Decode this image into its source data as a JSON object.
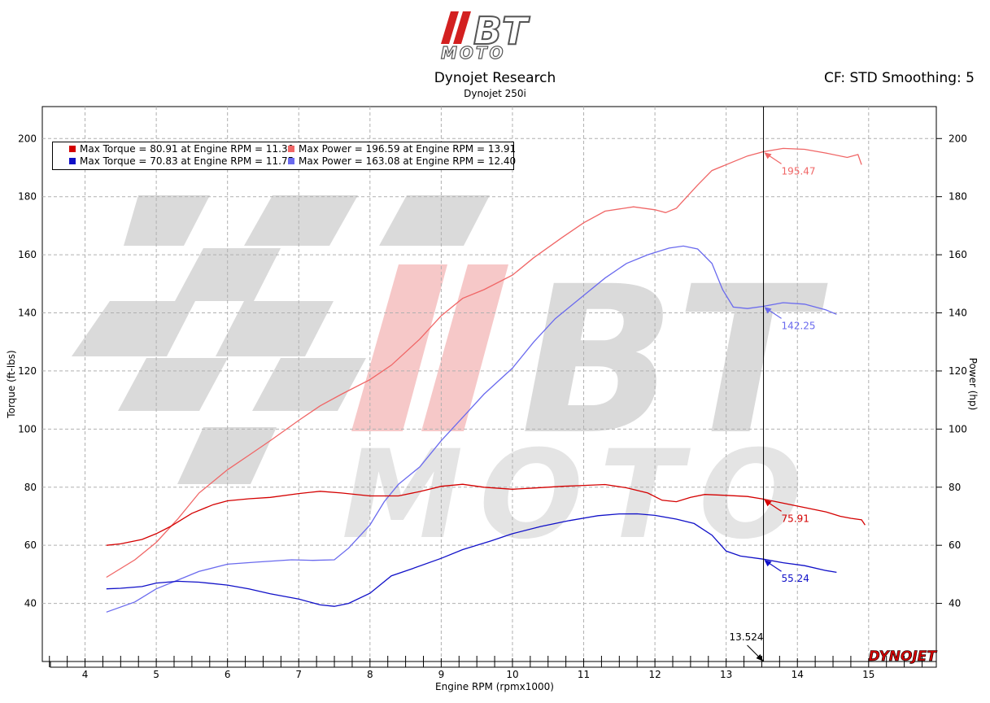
{
  "logo": {
    "letters": "BT",
    "sub": "MOTO"
  },
  "header": {
    "title": "Dynojet Research",
    "subtitle": "Dynojet 250i",
    "correction": "CF: STD Smoothing: 5"
  },
  "watermark": {
    "letters": "BT",
    "sub": "MOTO"
  },
  "brand_mark": "DYNOJET",
  "colors": {
    "torque_red": "#d40000",
    "power_red": "#f06666",
    "torque_blue": "#1010c8",
    "power_blue": "#6a6aee"
  },
  "chart_data": {
    "type": "line",
    "xlabel": "Engine RPM (rpmx1000)",
    "ylabel": "Torque (ft-lbs)",
    "y2label": "Power (hp)",
    "xlim": [
      3.4,
      15.95
    ],
    "ylim": [
      20,
      211
    ],
    "y2lim": [
      20,
      211
    ],
    "x_ticks": [
      4,
      5,
      6,
      7,
      8,
      9,
      10,
      11,
      12,
      13,
      14,
      15
    ],
    "y_ticks": [
      40,
      60,
      80,
      100,
      120,
      140,
      160,
      180,
      200
    ],
    "grid": true,
    "legend": {
      "placement": "top-left",
      "entries": [
        "Max Torque = 80.91 at Engine RPM = 11.30",
        "Max Power = 196.59 at Engine RPM = 13.91",
        "Max Torque = 70.83 at Engine RPM = 11.75",
        "Max Power = 163.08 at Engine RPM = 12.40"
      ]
    },
    "cursor": {
      "x": 13.524,
      "label": "13.524"
    },
    "series": [
      {
        "color": "#f06666",
        "axis": "right",
        "cursor_value": "195.47",
        "points": [
          [
            4.3,
            49
          ],
          [
            4.7,
            55
          ],
          [
            5.0,
            61
          ],
          [
            5.3,
            69
          ],
          [
            5.6,
            78
          ],
          [
            6.0,
            86
          ],
          [
            6.3,
            91
          ],
          [
            6.6,
            96
          ],
          [
            7.0,
            103
          ],
          [
            7.3,
            108
          ],
          [
            7.6,
            112
          ],
          [
            8.0,
            117
          ],
          [
            8.3,
            122
          ],
          [
            8.7,
            131
          ],
          [
            9.0,
            139
          ],
          [
            9.3,
            145
          ],
          [
            9.6,
            148
          ],
          [
            10.0,
            153
          ],
          [
            10.3,
            159
          ],
          [
            10.7,
            166
          ],
          [
            11.0,
            171
          ],
          [
            11.3,
            175
          ],
          [
            11.7,
            176.5
          ],
          [
            12.0,
            175.5
          ],
          [
            12.15,
            174.5
          ],
          [
            12.3,
            176
          ],
          [
            12.6,
            184
          ],
          [
            12.8,
            189
          ],
          [
            13.1,
            192
          ],
          [
            13.3,
            194
          ],
          [
            13.52,
            195.47
          ],
          [
            13.8,
            196.6
          ],
          [
            14.1,
            196.3
          ],
          [
            14.4,
            195
          ],
          [
            14.7,
            193.5
          ],
          [
            14.85,
            194.5
          ],
          [
            14.9,
            191
          ]
        ]
      },
      {
        "color": "#6a6aee",
        "axis": "right",
        "cursor_value": "142.25",
        "points": [
          [
            4.3,
            37
          ],
          [
            4.7,
            40.5
          ],
          [
            5.0,
            45
          ],
          [
            5.3,
            48
          ],
          [
            5.6,
            51
          ],
          [
            6.0,
            53.5
          ],
          [
            6.4,
            54.2
          ],
          [
            6.9,
            55
          ],
          [
            7.2,
            54.8
          ],
          [
            7.5,
            55
          ],
          [
            7.7,
            59
          ],
          [
            8.0,
            67
          ],
          [
            8.2,
            75
          ],
          [
            8.4,
            81
          ],
          [
            8.7,
            87
          ],
          [
            9.0,
            96
          ],
          [
            9.3,
            104
          ],
          [
            9.6,
            112
          ],
          [
            10.0,
            121
          ],
          [
            10.3,
            130
          ],
          [
            10.6,
            138
          ],
          [
            11.0,
            146
          ],
          [
            11.3,
            152
          ],
          [
            11.6,
            157
          ],
          [
            11.9,
            160
          ],
          [
            12.2,
            162.3
          ],
          [
            12.4,
            163
          ],
          [
            12.6,
            162
          ],
          [
            12.8,
            157
          ],
          [
            12.95,
            148
          ],
          [
            13.1,
            142
          ],
          [
            13.3,
            141.5
          ],
          [
            13.52,
            142.25
          ],
          [
            13.8,
            143.5
          ],
          [
            14.1,
            143
          ],
          [
            14.4,
            141
          ],
          [
            14.55,
            139.5
          ]
        ]
      },
      {
        "color": "#d40000",
        "axis": "left",
        "cursor_value": "75.91",
        "points": [
          [
            4.3,
            60
          ],
          [
            4.5,
            60.5
          ],
          [
            4.8,
            62
          ],
          [
            5.0,
            64
          ],
          [
            5.2,
            66.5
          ],
          [
            5.5,
            71
          ],
          [
            5.8,
            74
          ],
          [
            6.0,
            75.3
          ],
          [
            6.3,
            76
          ],
          [
            6.6,
            76.5
          ],
          [
            7.0,
            77.8
          ],
          [
            7.3,
            78.6
          ],
          [
            7.6,
            78
          ],
          [
            8.0,
            77
          ],
          [
            8.4,
            77
          ],
          [
            8.7,
            78.5
          ],
          [
            9.0,
            80.3
          ],
          [
            9.3,
            81
          ],
          [
            9.6,
            80
          ],
          [
            10.0,
            79.3
          ],
          [
            10.3,
            79.7
          ],
          [
            10.7,
            80.3
          ],
          [
            11.0,
            80.6
          ],
          [
            11.3,
            80.9
          ],
          [
            11.6,
            79.8
          ],
          [
            11.9,
            78
          ],
          [
            12.1,
            75.5
          ],
          [
            12.3,
            75
          ],
          [
            12.5,
            76.5
          ],
          [
            12.7,
            77.5
          ],
          [
            13.0,
            77.2
          ],
          [
            13.3,
            76.8
          ],
          [
            13.52,
            75.91
          ],
          [
            13.8,
            74.5
          ],
          [
            14.1,
            73
          ],
          [
            14.4,
            71.5
          ],
          [
            14.6,
            70
          ],
          [
            14.75,
            69.3
          ],
          [
            14.9,
            68.8
          ],
          [
            14.95,
            67
          ]
        ]
      },
      {
        "color": "#1010c8",
        "axis": "left",
        "cursor_value": "55.24",
        "points": [
          [
            4.3,
            45
          ],
          [
            4.5,
            45.2
          ],
          [
            4.8,
            45.8
          ],
          [
            5.0,
            47
          ],
          [
            5.3,
            47.6
          ],
          [
            5.6,
            47.3
          ],
          [
            6.0,
            46.3
          ],
          [
            6.3,
            45
          ],
          [
            6.6,
            43.3
          ],
          [
            7.0,
            41.5
          ],
          [
            7.3,
            39.5
          ],
          [
            7.5,
            39
          ],
          [
            7.7,
            40
          ],
          [
            8.0,
            43.5
          ],
          [
            8.3,
            49.5
          ],
          [
            8.6,
            52
          ],
          [
            9.0,
            55.5
          ],
          [
            9.3,
            58.5
          ],
          [
            9.7,
            61.5
          ],
          [
            10.0,
            64
          ],
          [
            10.4,
            66.5
          ],
          [
            10.8,
            68.5
          ],
          [
            11.2,
            70.2
          ],
          [
            11.5,
            70.8
          ],
          [
            11.75,
            70.83
          ],
          [
            12.0,
            70.3
          ],
          [
            12.3,
            69
          ],
          [
            12.55,
            67.5
          ],
          [
            12.8,
            63.5
          ],
          [
            13.0,
            58
          ],
          [
            13.2,
            56.3
          ],
          [
            13.52,
            55.24
          ],
          [
            13.8,
            54
          ],
          [
            14.1,
            53
          ],
          [
            14.4,
            51.3
          ],
          [
            14.55,
            50.7
          ]
        ]
      }
    ]
  }
}
